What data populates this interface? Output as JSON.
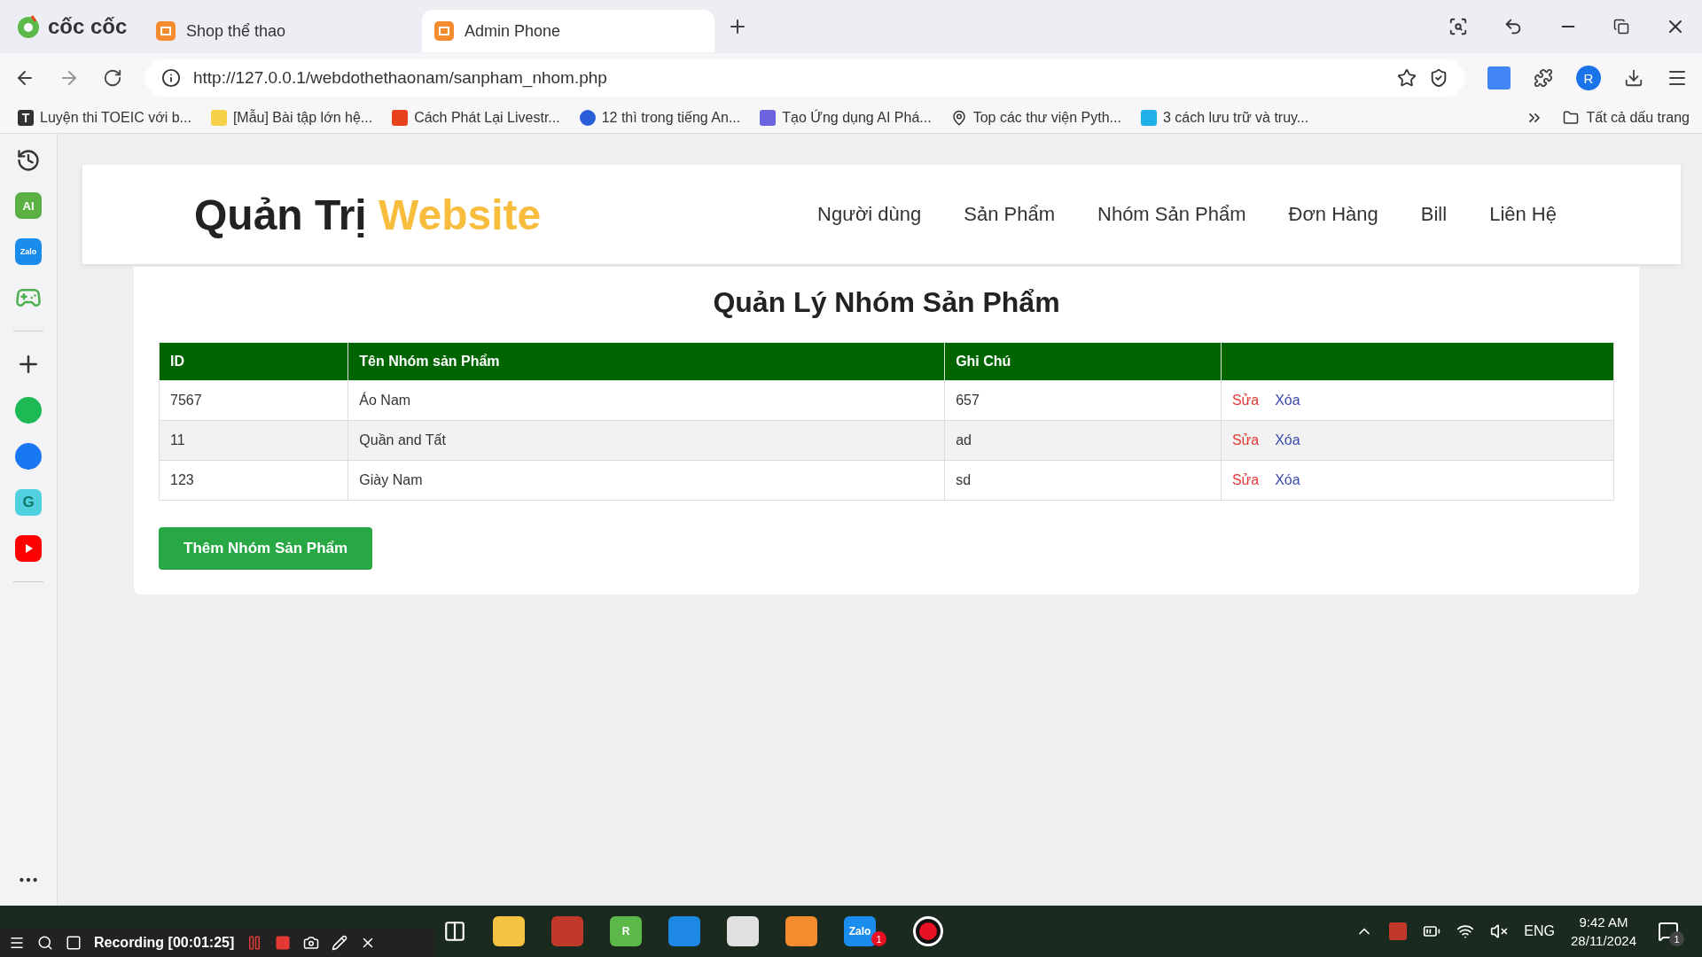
{
  "browser": {
    "brand": "cốc cốc",
    "tabs": [
      {
        "title": "Shop thể thao",
        "selected": false
      },
      {
        "title": "Admin Phone",
        "selected": true
      }
    ],
    "address": "http://127.0.0.1/webdothethaonam/sanpham_nhom.php",
    "profile_initial": "R",
    "bookmarks": [
      {
        "kind": "letter",
        "badge": "T",
        "title": "Luyện thi TOEIC với b..."
      },
      {
        "kind": "yellow",
        "title": "[Mẫu] Bài tập lớn hệ..."
      },
      {
        "kind": "red",
        "title": "Cách Phát Lại Livestr..."
      },
      {
        "kind": "circle",
        "title": "12 thì trong tiếng An..."
      },
      {
        "kind": "purple",
        "title": "Tạo Ứng dụng AI Phá..."
      },
      {
        "kind": "pin",
        "title": "Top các thư viện Pyth..."
      },
      {
        "kind": "cyan",
        "title": "3 cách lưu trữ và truy..."
      }
    ],
    "all_bookmarks": "Tất cả dấu trang"
  },
  "sidebar_apps": [
    {
      "kind": "history"
    },
    {
      "kind": "ai",
      "label": "AI"
    },
    {
      "kind": "zalo",
      "label": "Zalo"
    },
    {
      "kind": "game"
    },
    {
      "kind": "divider"
    },
    {
      "kind": "add"
    },
    {
      "kind": "spotify"
    },
    {
      "kind": "facebook"
    },
    {
      "kind": "grammar",
      "label": "G"
    },
    {
      "kind": "youtube"
    },
    {
      "kind": "divider"
    }
  ],
  "header": {
    "title": "Quản Trị",
    "title_accent": "Website",
    "nav": [
      "Người dùng",
      "Sản Phẩm",
      "Nhóm Sản Phẩm",
      "Đơn Hàng",
      "Bill",
      "Liên Hệ"
    ]
  },
  "page": {
    "heading": "Quản Lý Nhóm Sản Phẩm",
    "columns": [
      "ID",
      "Tên Nhóm sản Phẩm",
      "Ghi Chú"
    ],
    "rows": [
      {
        "id": "7567",
        "name": "Áo Nam",
        "note": "657",
        "edit": "Sửa",
        "delete": "Xóa"
      },
      {
        "id": "11",
        "name": "Quần and Tất",
        "note": "ad",
        "edit": "Sửa",
        "delete": "Xóa"
      },
      {
        "id": "123",
        "name": "Giày Nam",
        "note": "sd",
        "edit": "Sửa",
        "delete": "Xóa"
      }
    ],
    "add_button": "Thêm Nhóm Sản Phẩm"
  },
  "recorder": {
    "status": "Recording [00:01:25]"
  },
  "taskbar": {
    "profile_badge": "R",
    "chat_label": "Zalo",
    "chat_badge": "1",
    "language": "ENG",
    "time": "9:42 AM",
    "date": "28/11/2024",
    "notification_badge": "1"
  }
}
